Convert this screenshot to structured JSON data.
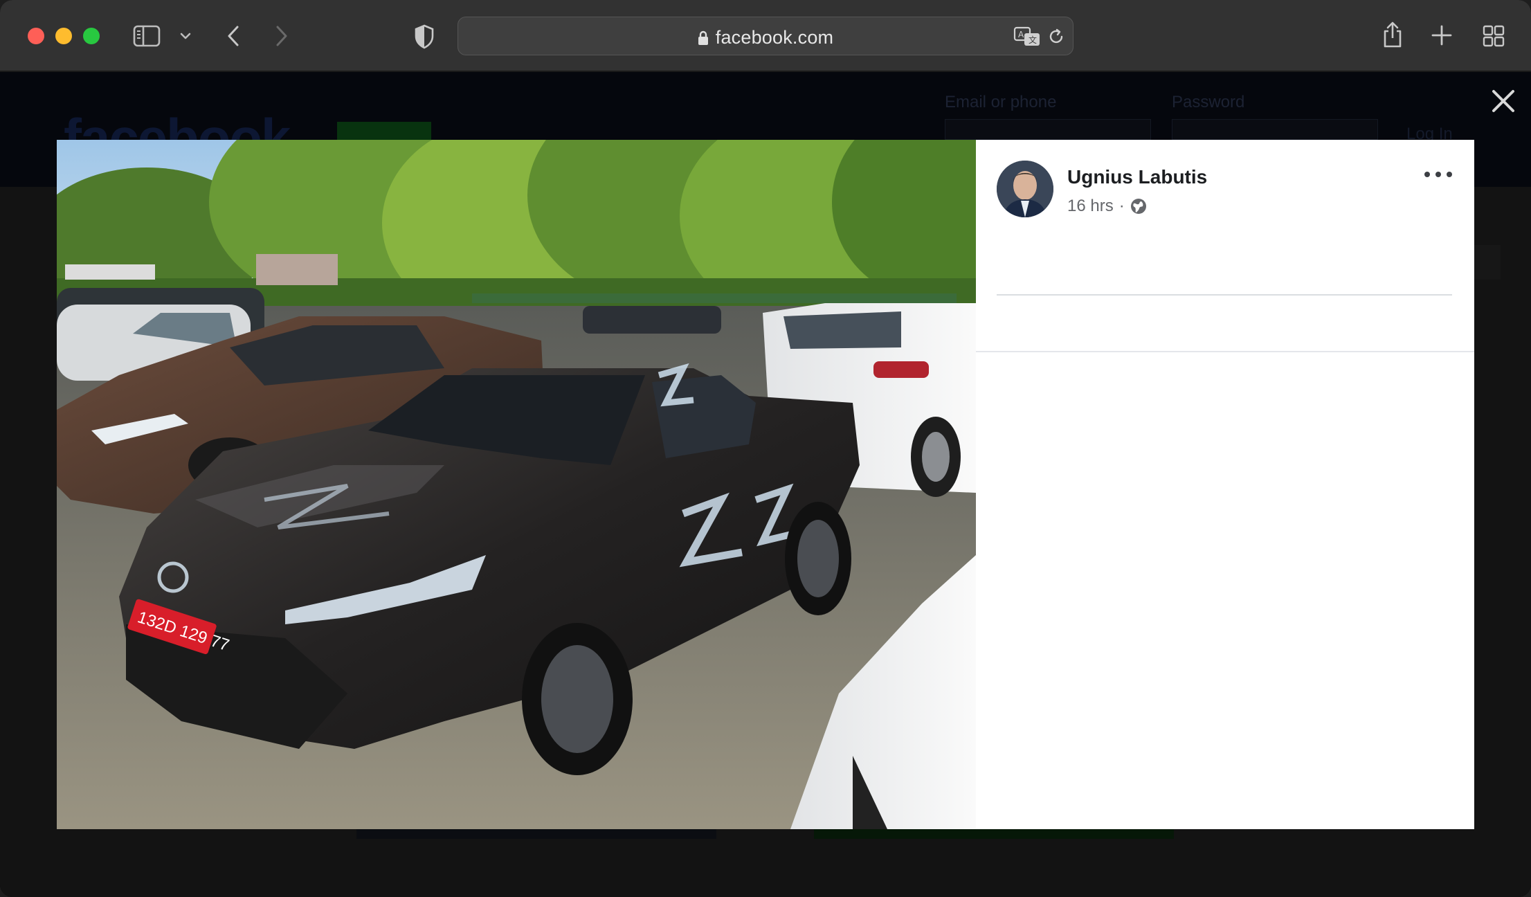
{
  "browser": {
    "url": "facebook.com",
    "accent_colors": {
      "close": "#fe5f57",
      "minimize": "#febc2e",
      "zoom": "#28c840"
    }
  },
  "facebook_bg": {
    "logo": "facebook",
    "email_label": "Email or phone",
    "password_label": "Password",
    "login_label": "Log In"
  },
  "post": {
    "author": "Ugnius Labutis",
    "time": "16 hrs",
    "separator": "·",
    "audience_icon": "globe-icon",
    "photo_plate": "132D 129 77"
  }
}
